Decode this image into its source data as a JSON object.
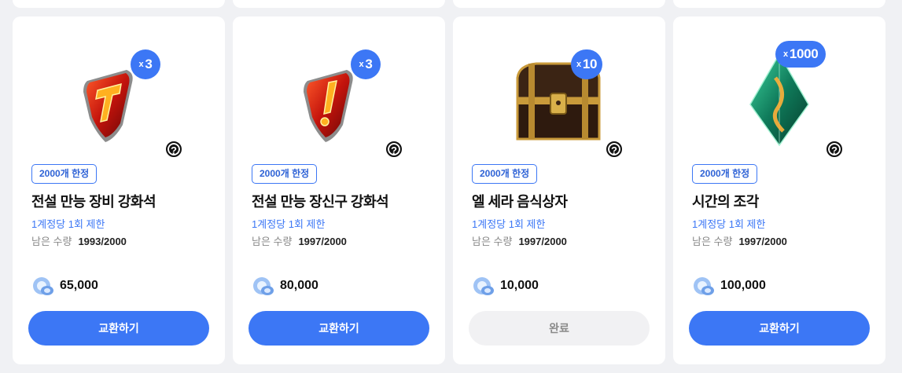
{
  "cards": [
    {
      "name": "전설 만능 장비 강화석",
      "limit_tag": "2000개 한정",
      "account_limit": "1계정당 1회 제한",
      "remaining_label": "남은 수량",
      "remaining_value": "1993/2000",
      "price": "65,000",
      "button": "교환하기",
      "button_state": "active",
      "qty_prefix": "x",
      "qty": "3",
      "icon": "red-gem-hammer-icon",
      "help": "?"
    },
    {
      "name": "전설 만능 장신구 강화석",
      "limit_tag": "2000개 한정",
      "account_limit": "1계정당 1회 제한",
      "remaining_label": "남은 수량",
      "remaining_value": "1997/2000",
      "price": "80,000",
      "button": "교환하기",
      "button_state": "active",
      "qty_prefix": "x",
      "qty": "3",
      "icon": "red-gem-accessory-icon",
      "help": "?"
    },
    {
      "name": "엘 세라 음식상자",
      "limit_tag": "2000개 한정",
      "account_limit": "1계정당 1회 제한",
      "remaining_label": "남은 수량",
      "remaining_value": "1997/2000",
      "price": "10,000",
      "button": "완료",
      "button_state": "done",
      "qty_prefix": "x",
      "qty": "10",
      "icon": "treasure-chest-icon",
      "help": "?"
    },
    {
      "name": "시간의 조각",
      "limit_tag": "2000개 한정",
      "account_limit": "1계정당 1회 제한",
      "remaining_label": "남은 수량",
      "remaining_value": "1997/2000",
      "price": "100,000",
      "button": "교환하기",
      "button_state": "active",
      "qty_prefix": "x",
      "qty": "1000",
      "icon": "green-crystal-icon",
      "help": "?"
    }
  ],
  "colors": {
    "accent": "#3c77f5",
    "background": "#f0f1f4",
    "done_button": "#f1f1f3"
  }
}
